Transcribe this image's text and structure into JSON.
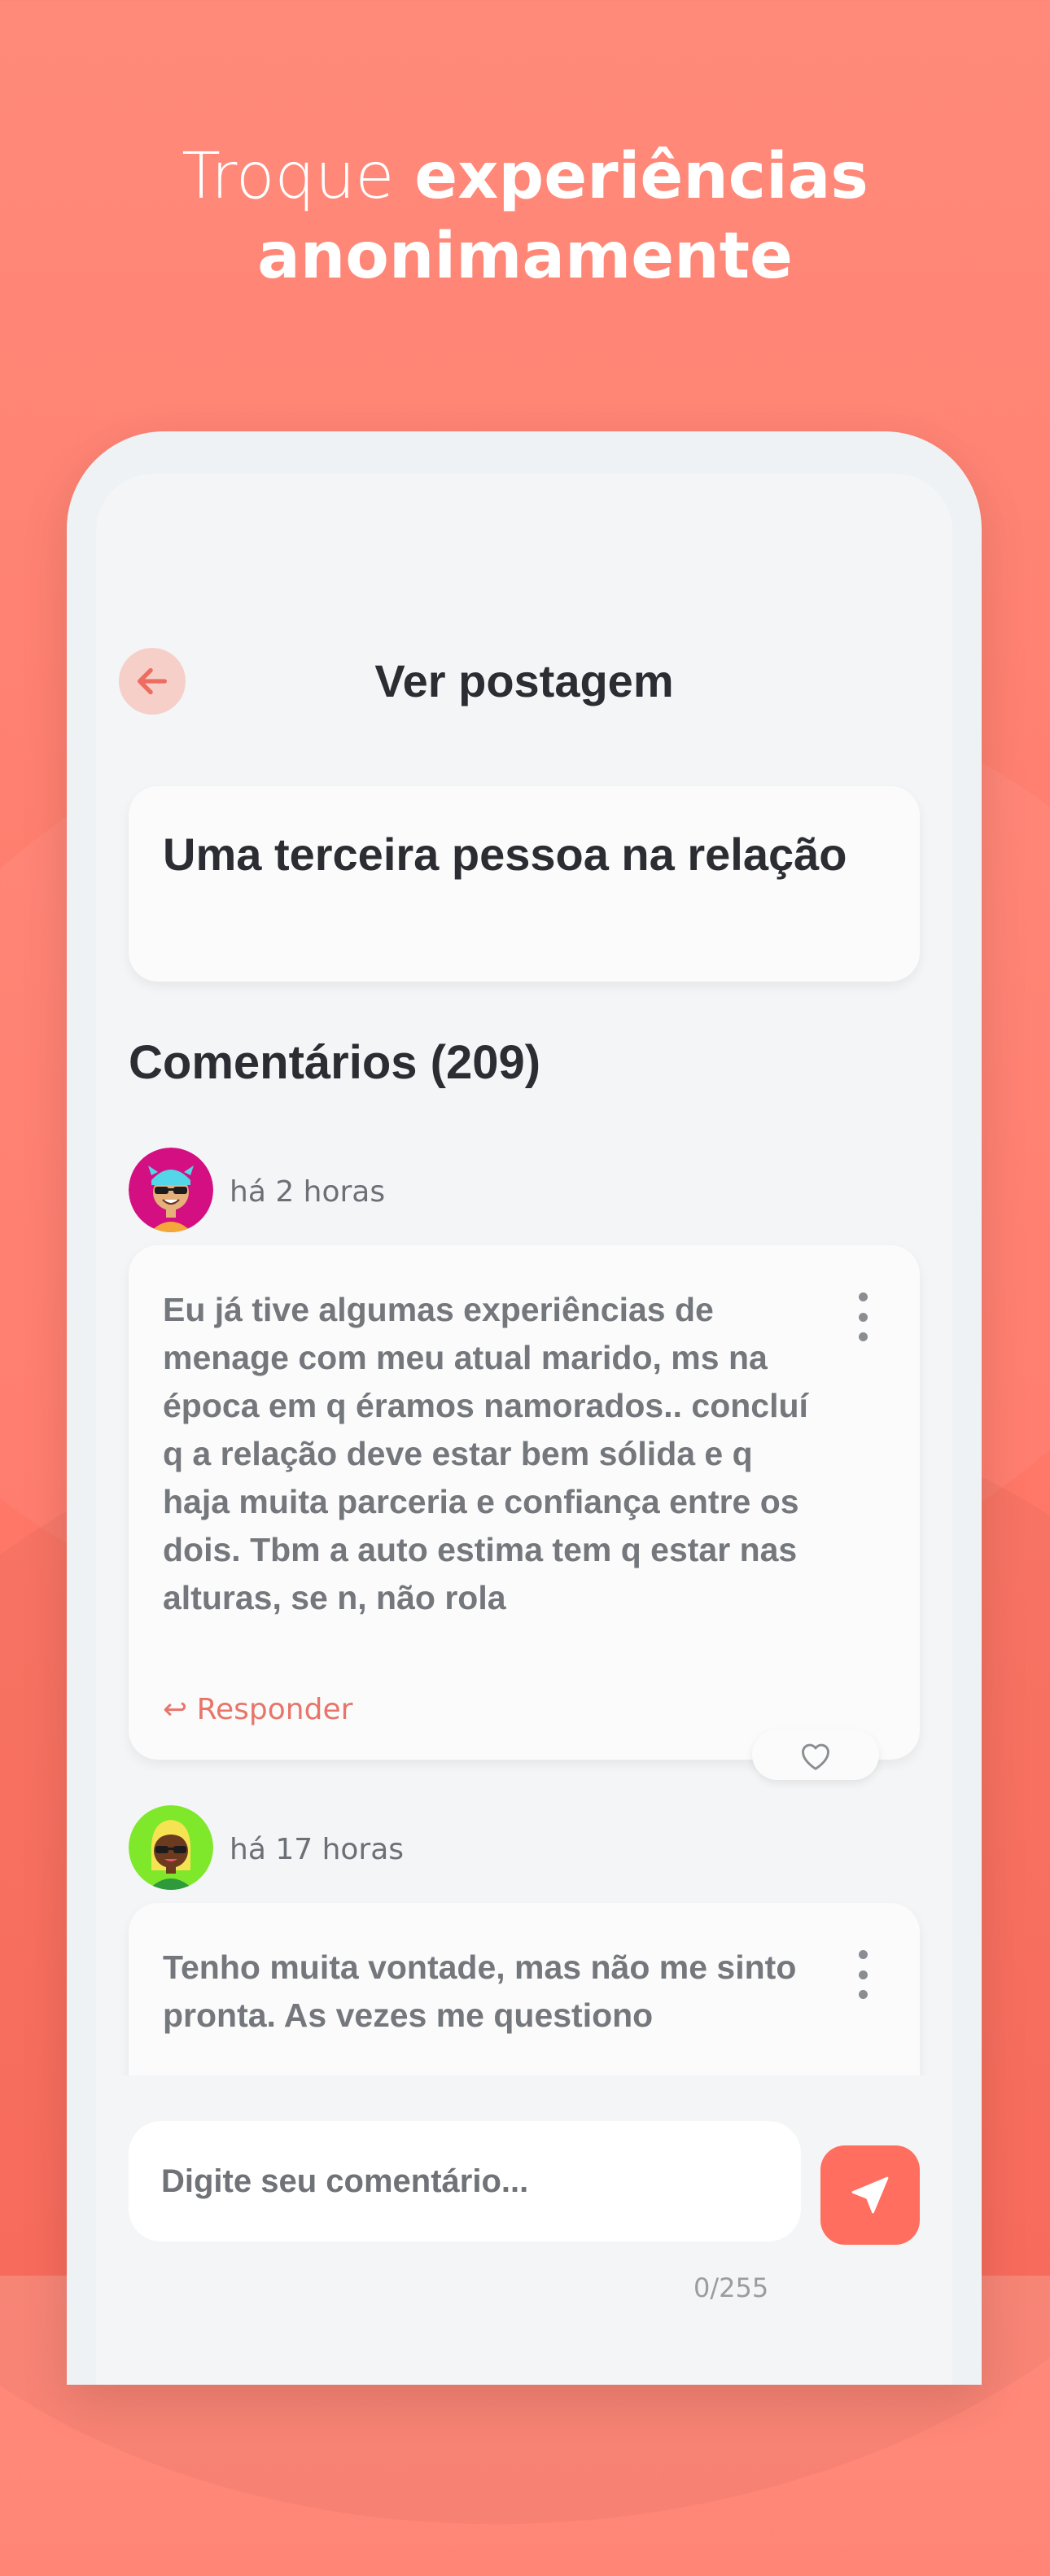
{
  "headline": {
    "light": "Troque ",
    "bold": "experiências",
    "line2": "anonimamente"
  },
  "header": {
    "title": "Ver postagem",
    "back_icon": "arrow-left-icon"
  },
  "post": {
    "title": "Uma terceira pessoa na relação"
  },
  "comments_section": {
    "heading": "Comentários (209)"
  },
  "comments": [
    {
      "time": "há 2 horas",
      "text": "Eu já tive algumas experiências de menage com meu atual marido, ms na época em q éramos namorados.. concluí q a relação deve estar bem sólida e q haja muita parceria e confiança entre os dois. Tbm a auto estima tem q estar nas alturas, se n, não rola",
      "reply_label": "↩ Responder",
      "avatar_bg": "#d40f82"
    },
    {
      "time": "há 17 horas",
      "text": "Tenho muita vontade, mas não me sinto pronta. As vezes me questiono",
      "avatar_bg": "#7fe82a"
    }
  ],
  "composer": {
    "placeholder": "Digite seu comentário...",
    "counter": "0/255",
    "send_icon": "send-icon"
  },
  "colors": {
    "accent": "#ff6e5e",
    "reply": "#e8756a",
    "text_dark": "#2b2d33",
    "text_muted": "#74777c"
  }
}
